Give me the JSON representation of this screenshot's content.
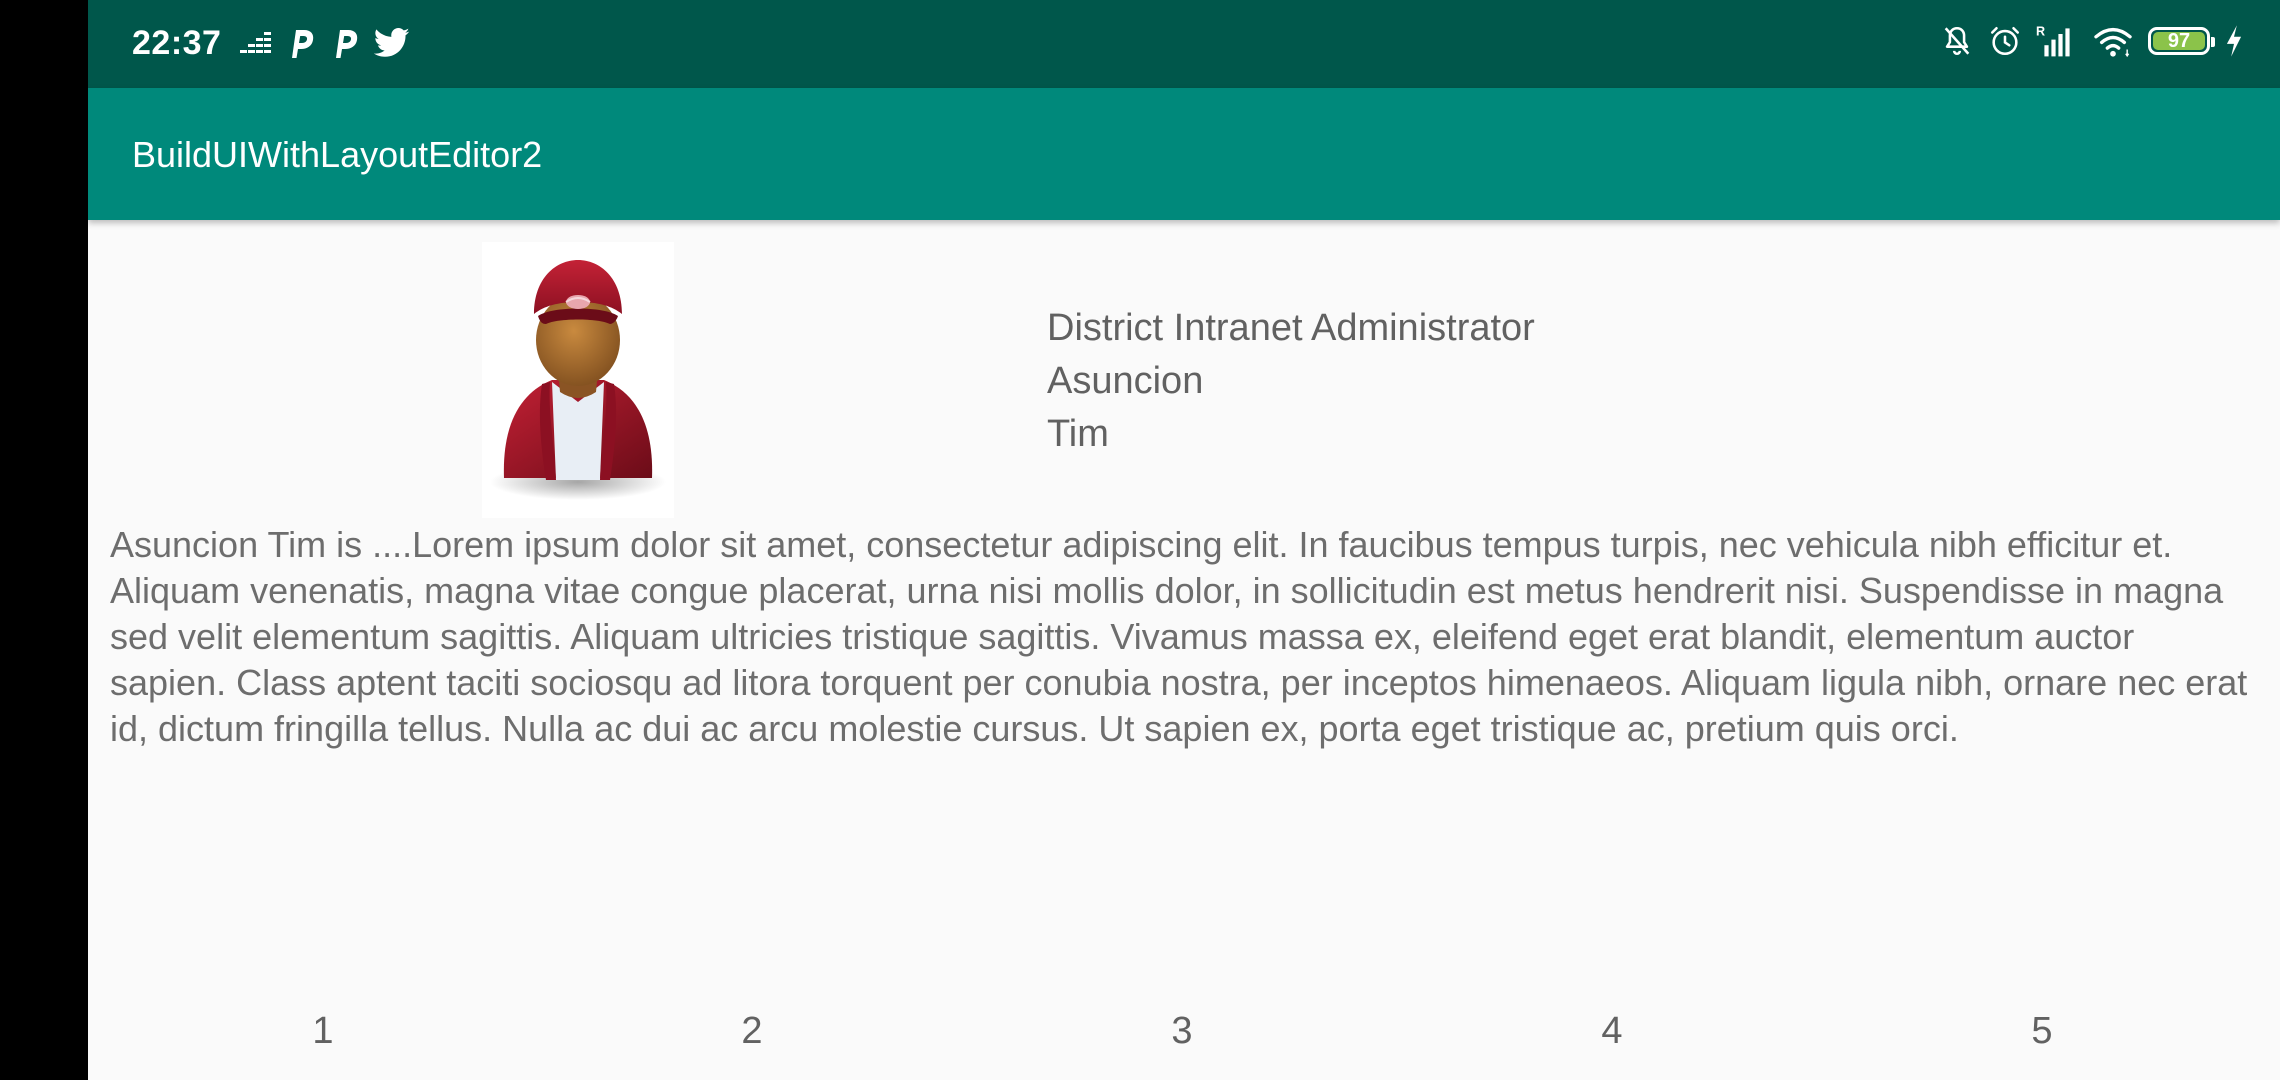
{
  "status_bar": {
    "time": "22:37",
    "left_icons": [
      "deezer-icon",
      "parking-p-icon",
      "parking-p-icon",
      "twitter-icon"
    ],
    "right_icons": [
      "muted-bell-icon",
      "alarm-icon",
      "signal-roaming-icon",
      "wifi-icon"
    ],
    "battery_level": "97",
    "battery_fraction": 0.97,
    "background_color": "#00574b",
    "battery_color": "#8bc34a"
  },
  "app_bar": {
    "title": "BuildUIWithLayoutEditor2",
    "color": "#00897b"
  },
  "profile": {
    "avatar_icon": "user-avatar-icon",
    "role": "District Intranet Administrator",
    "last_name": "Asuncion",
    "first_name": "Tim"
  },
  "bio": {
    "text": "Asuncion Tim is ....Lorem ipsum dolor sit amet, consectetur adipiscing elit. In faucibus tempus turpis, nec vehicula nibh efficitur et. Aliquam venenatis, magna vitae congue placerat, urna nisi mollis dolor, in sollicitudin est metus hendrerit nisi. Suspendisse in magna sed velit elementum sagittis. Aliquam ultricies tristique sagittis. Vivamus massa ex, eleifend eget erat blandit, elementum auctor sapien. Class aptent taciti sociosqu ad litora torquent per conubia nostra, per inceptos himenaeos. Aliquam ligula nibh, ornare nec erat id, dictum fringilla tellus. Nulla ac dui ac arcu molestie cursus. Ut sapien ex, porta eget tristique ac, pretium quis orci."
  },
  "pager": {
    "items": [
      "1",
      "2",
      "3",
      "4",
      "5"
    ]
  }
}
